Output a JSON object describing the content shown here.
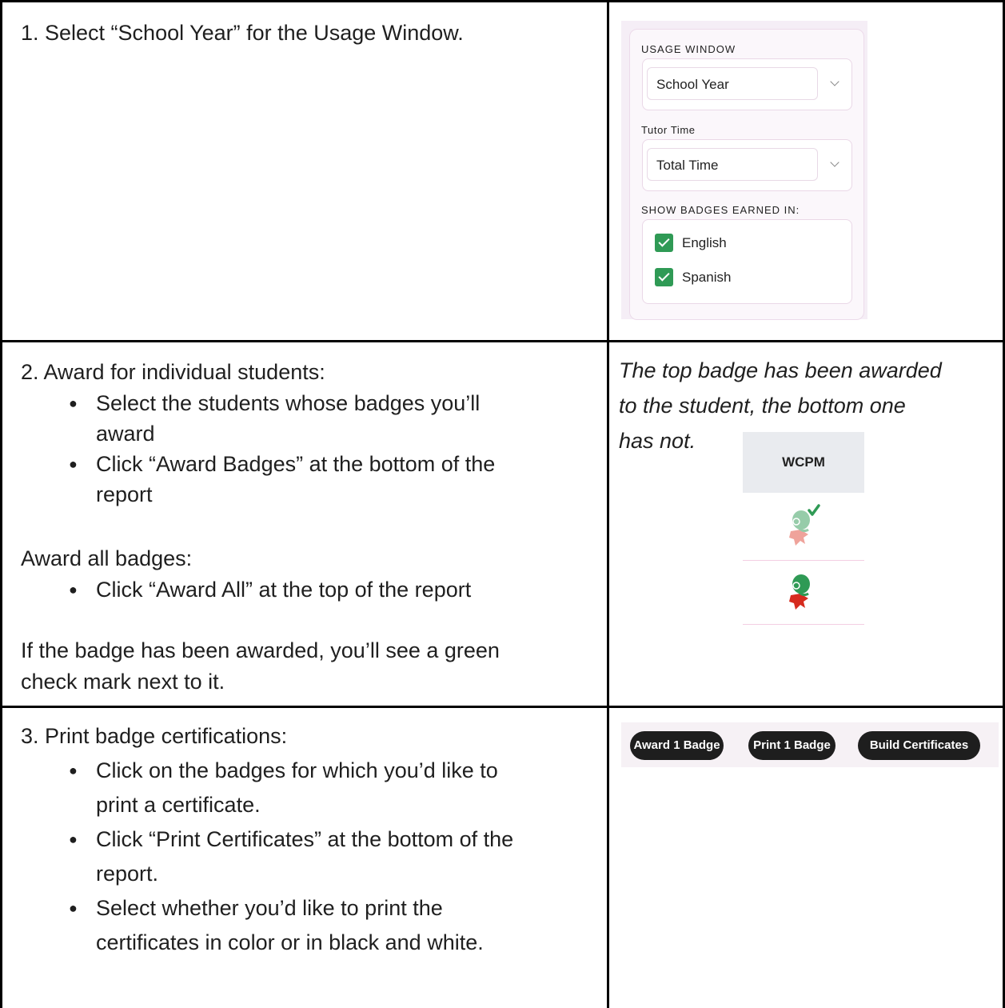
{
  "rows": [
    {
      "text": "1. Select “School Year” for the Usage Window."
    },
    {
      "heading1": "2. Award for individual students:",
      "bullets1": [
        "Select the students whose badges you’ll",
        "award",
        "Click “Award Badges” at the bottom of the",
        "report"
      ],
      "heading2": "Award all badges:",
      "bullets2": [
        "Click “Award All” at the top of the report"
      ],
      "note_lines": [
        "If the badge has been awarded, you’ll see a green",
        "check mark next to it."
      ],
      "caption_lines": [
        "The top badge has been awarded",
        "to the student, the bottom one",
        "has not."
      ]
    },
    {
      "heading": "3. Print badge certifications:",
      "bullets": [
        "Click on the badges for which you’d like to",
        "print a certificate.",
        "Click “Print Certificates” at the bottom of the",
        "report.",
        "Select whether you’d like to print the",
        "certificates in color or in black and white."
      ]
    }
  ],
  "filter_panel": {
    "usage_window_label": "USAGE WINDOW",
    "usage_window_value": "School Year",
    "tutor_time_label": "Tutor Time",
    "tutor_time_value": "Total Time",
    "badges_label": "SHOW BADGES EARNED IN:",
    "languages": [
      {
        "label": "English",
        "checked": true
      },
      {
        "label": "Spanish",
        "checked": true
      }
    ],
    "check_color": "#2f9a55"
  },
  "badge_table": {
    "header": "WCPM",
    "rows": [
      {
        "icon": "reader-badge-icon",
        "awarded": true
      },
      {
        "icon": "reader-badge-icon",
        "awarded": false
      }
    ]
  },
  "buttons": {
    "award": "Award 1 Badge",
    "print": "Print 1 Badge",
    "build": "Build Certificates"
  }
}
